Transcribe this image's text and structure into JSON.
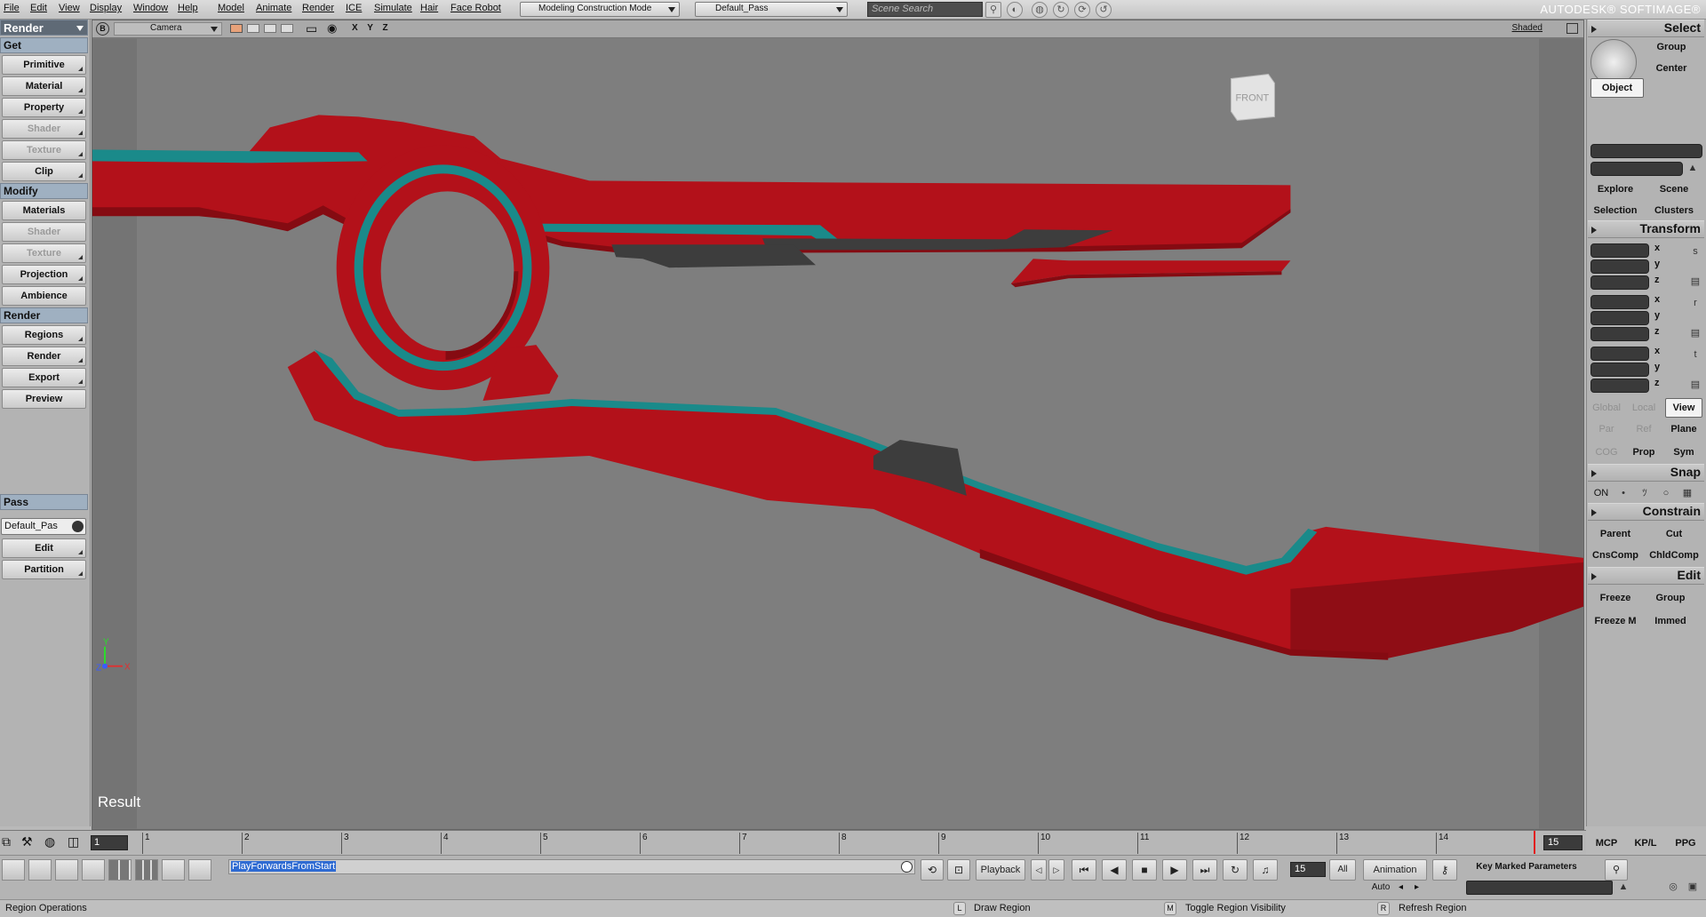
{
  "menu": [
    "File",
    "Edit",
    "View",
    "Display",
    "Window",
    "Help",
    "Model",
    "Animate",
    "Render",
    "ICE",
    "Simulate",
    "Hair",
    "Face Robot"
  ],
  "toolbar": {
    "construction_mode": "Modeling Construction Mode",
    "pass": "Default_Pass",
    "search_placeholder": "Scene Search",
    "brand": "AUTODESK® SOFTIMAGE®"
  },
  "left_panel": {
    "mode": "Render",
    "get_title": "Get",
    "get_items": [
      "Primitive",
      "Material",
      "Property",
      "Shader",
      "Texture",
      "Clip"
    ],
    "modify_title": "Modify",
    "modify_items": [
      "Materials",
      "Shader",
      "Texture",
      "Projection",
      "Ambience"
    ],
    "render_title": "Render",
    "render_items": [
      "Regions",
      "Render",
      "Export",
      "Preview"
    ],
    "pass_title": "Pass",
    "pass_value": "Default_Pas",
    "pass_items": [
      "Edit",
      "Partition"
    ]
  },
  "viewport": {
    "letter": "B",
    "camera": "Camera",
    "xyz": "X Y Z",
    "display_mode": "Shaded",
    "navcube_label": "FRONT",
    "result_label": "Result",
    "axis_y": "Y",
    "axis_x": "X",
    "axis_z": "Z",
    "colors": {
      "body": "#b3111a",
      "accent": "#1a8a8a",
      "metal": "#3d3d3d",
      "background": "#7e7e7e"
    }
  },
  "right_panel": {
    "select_title": "Select",
    "group": "Group",
    "center": "Center",
    "object": "Object",
    "explore": "Explore",
    "scene": "Scene",
    "selection": "Selection",
    "clusters": "Clusters",
    "transform_title": "Transform",
    "axes": [
      "x",
      "y",
      "z"
    ],
    "global": "Global",
    "local": "Local",
    "view": "View",
    "par": "Par",
    "ref": "Ref",
    "plane": "Plane",
    "cog": "COG",
    "prop": "Prop",
    "sym": "Sym",
    "snap_title": "Snap",
    "snap_on": "ON",
    "constrain_title": "Constrain",
    "parent": "Parent",
    "cut": "Cut",
    "cnscomp": "CnsComp",
    "chldcomp": "ChldComp",
    "edit_title": "Edit",
    "freeze": "Freeze",
    "edit_group": "Group",
    "freeze_m": "Freeze M",
    "immed": "Immed",
    "mcp": "MCP",
    "kpl": "KP/L",
    "ppg": "PPG",
    "key_marked": "Key Marked Parameters"
  },
  "timeline": {
    "start": "1",
    "end": "15",
    "ticks": [
      "1",
      "2",
      "3",
      "4",
      "5",
      "6",
      "7",
      "8",
      "9",
      "10",
      "11",
      "12",
      "13",
      "14"
    ]
  },
  "playback": {
    "script": "PlayForwardsFromStart",
    "playback_label": "Playback",
    "current_frame": "15",
    "all": "All",
    "animation": "Animation",
    "auto": "Auto"
  },
  "status": {
    "left": "Region Operations",
    "l_key": "L",
    "l_action": "Draw Region",
    "m_key": "M",
    "m_action": "Toggle Region Visibility",
    "r_key": "R",
    "r_action": "Refresh Region"
  }
}
